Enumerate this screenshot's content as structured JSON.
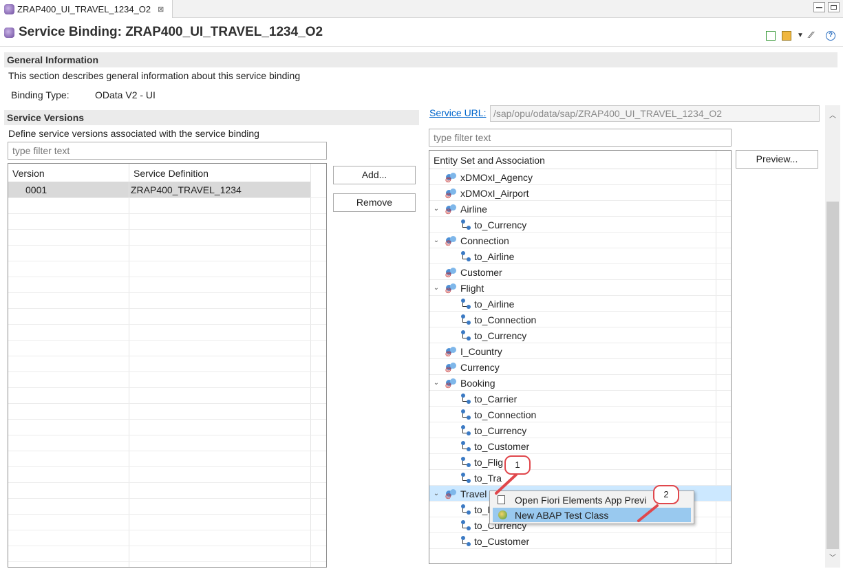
{
  "tab": {
    "title": "ZRAP400_UI_TRAVEL_1234_O2",
    "close_glyph": "⊠"
  },
  "header": {
    "title": "Service Binding: ZRAP400_UI_TRAVEL_1234_O2"
  },
  "general": {
    "heading": "General Information",
    "description": "This section describes general information about this service binding",
    "binding_type_label": "Binding Type:",
    "binding_type_value": "OData V2 - UI"
  },
  "versions": {
    "heading": "Service Versions",
    "description": "Define service versions associated with the service binding",
    "filter_placeholder": "type filter text",
    "columns": [
      "Version",
      "Service Definition"
    ],
    "rows": [
      {
        "version": "0001",
        "definition": "ZRAP400_TRAVEL_1234"
      }
    ],
    "add_label": "Add...",
    "remove_label": "Remove"
  },
  "service": {
    "url_label": "Service URL:",
    "url_value": "/sap/opu/odata/sap/ZRAP400_UI_TRAVEL_1234_O2",
    "filter_placeholder": "type filter text",
    "tree_header": "Entity Set and Association",
    "preview_label": "Preview...",
    "tree": [
      {
        "label": "xDMOxI_Agency",
        "kind": "entity",
        "level": 0,
        "expand": ""
      },
      {
        "label": "xDMOxI_Airport",
        "kind": "entity",
        "level": 0,
        "expand": ""
      },
      {
        "label": "Airline",
        "kind": "entity",
        "level": 0,
        "expand": "v"
      },
      {
        "label": "to_Currency",
        "kind": "assoc",
        "level": 1,
        "expand": ""
      },
      {
        "label": "Connection",
        "kind": "entity",
        "level": 0,
        "expand": "v"
      },
      {
        "label": "to_Airline",
        "kind": "assoc",
        "level": 1,
        "expand": ""
      },
      {
        "label": "Customer",
        "kind": "entity",
        "level": 0,
        "expand": ""
      },
      {
        "label": "Flight",
        "kind": "entity",
        "level": 0,
        "expand": "v"
      },
      {
        "label": "to_Airline",
        "kind": "assoc",
        "level": 1,
        "expand": ""
      },
      {
        "label": "to_Connection",
        "kind": "assoc",
        "level": 1,
        "expand": ""
      },
      {
        "label": "to_Currency",
        "kind": "assoc",
        "level": 1,
        "expand": ""
      },
      {
        "label": "I_Country",
        "kind": "entity",
        "level": 0,
        "expand": ""
      },
      {
        "label": "Currency",
        "kind": "entity",
        "level": 0,
        "expand": ""
      },
      {
        "label": "Booking",
        "kind": "entity",
        "level": 0,
        "expand": "v"
      },
      {
        "label": "to_Carrier",
        "kind": "assoc",
        "level": 1,
        "expand": ""
      },
      {
        "label": "to_Connection",
        "kind": "assoc",
        "level": 1,
        "expand": ""
      },
      {
        "label": "to_Currency",
        "kind": "assoc",
        "level": 1,
        "expand": ""
      },
      {
        "label": "to_Customer",
        "kind": "assoc",
        "level": 1,
        "expand": ""
      },
      {
        "label": "to_Flig",
        "kind": "assoc",
        "level": 1,
        "expand": ""
      },
      {
        "label": "to_Tra",
        "kind": "assoc",
        "level": 1,
        "expand": ""
      },
      {
        "label": "Travel",
        "kind": "entity",
        "level": 0,
        "expand": "v",
        "selected": true
      },
      {
        "label": "to_B",
        "kind": "assoc",
        "level": 1,
        "expand": ""
      },
      {
        "label": "to_Currency",
        "kind": "assoc",
        "level": 1,
        "expand": ""
      },
      {
        "label": "to_Customer",
        "kind": "assoc",
        "level": 1,
        "expand": ""
      }
    ]
  },
  "context_menu": {
    "items": [
      {
        "label": "Open Fiori Elements App Previ",
        "icon": "document-icon"
      },
      {
        "label": "New ABAP Test Class",
        "icon": "test-class-icon",
        "highlighted": true
      }
    ]
  },
  "callouts": [
    "1",
    "2"
  ],
  "colors": {
    "selection": "#cce8ff",
    "menu_highlight": "#99c9ef",
    "callout": "#e0474c",
    "link": "#0066cc"
  }
}
